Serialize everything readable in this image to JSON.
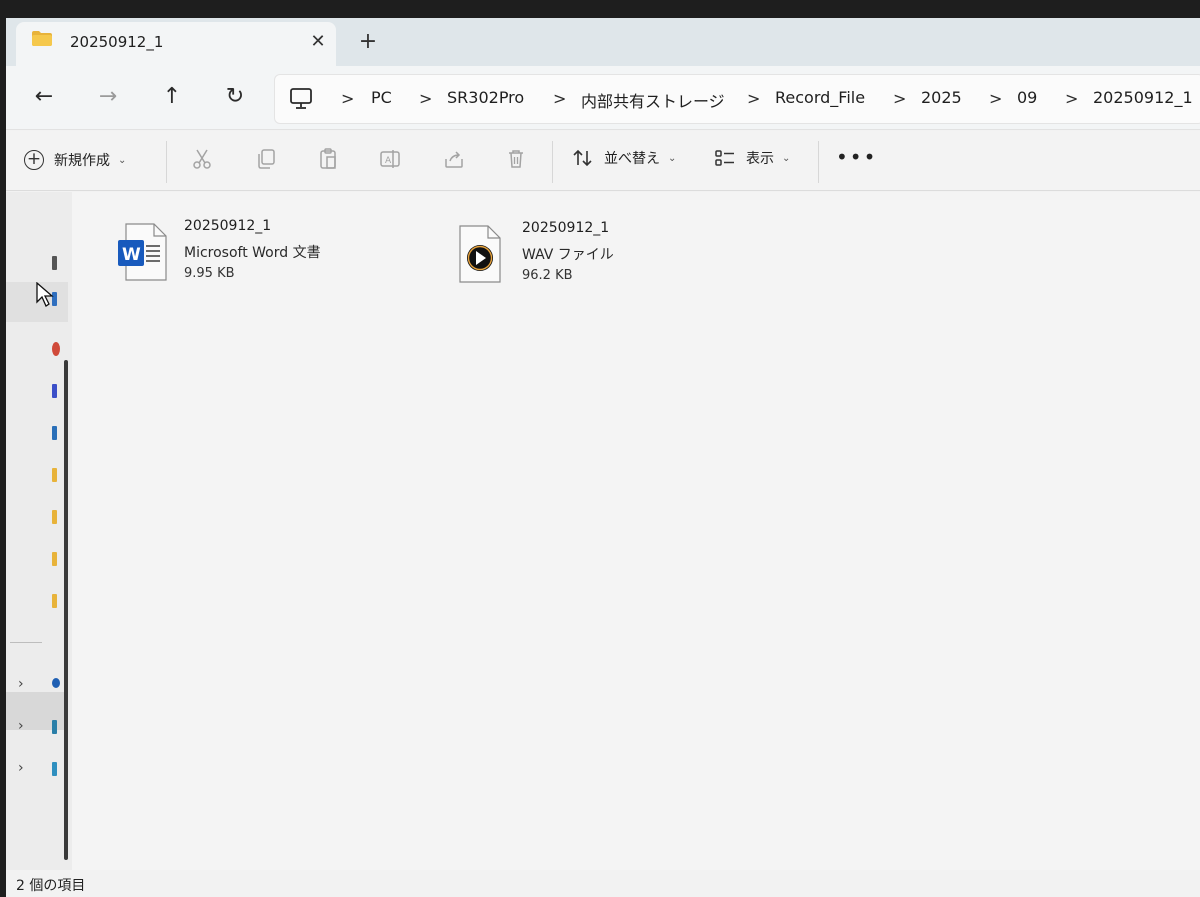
{
  "tab": {
    "title": "20250912_1",
    "close_label": "✕",
    "new_tab_label": "+"
  },
  "nav": {
    "back": "←",
    "forward": "→",
    "up": "↑",
    "refresh": "↻"
  },
  "breadcrumb": {
    "separator": ">",
    "items": [
      "PC",
      "SR302Pro",
      "内部共有ストレージ",
      "Record_File",
      "2025",
      "09",
      "20250912_1"
    ]
  },
  "commands": {
    "new_label": "新規作成",
    "sort_label": "並べ替え",
    "view_label": "表示",
    "more_label": "•••",
    "chevron": "⌄"
  },
  "files": [
    {
      "name": "20250912_1",
      "type": "Microsoft Word 文書",
      "size": "9.95 KB",
      "icon": "word-doc-icon"
    },
    {
      "name": "20250912_1",
      "type": "WAV ファイル",
      "size": "96.2 KB",
      "icon": "wav-audio-icon"
    }
  ],
  "status": {
    "item_count": "2 個の項目"
  },
  "colors": {
    "word_blue": "#185abd",
    "folder_yellow": "#e8b33a",
    "tab_strip": "#dfe6ea"
  }
}
